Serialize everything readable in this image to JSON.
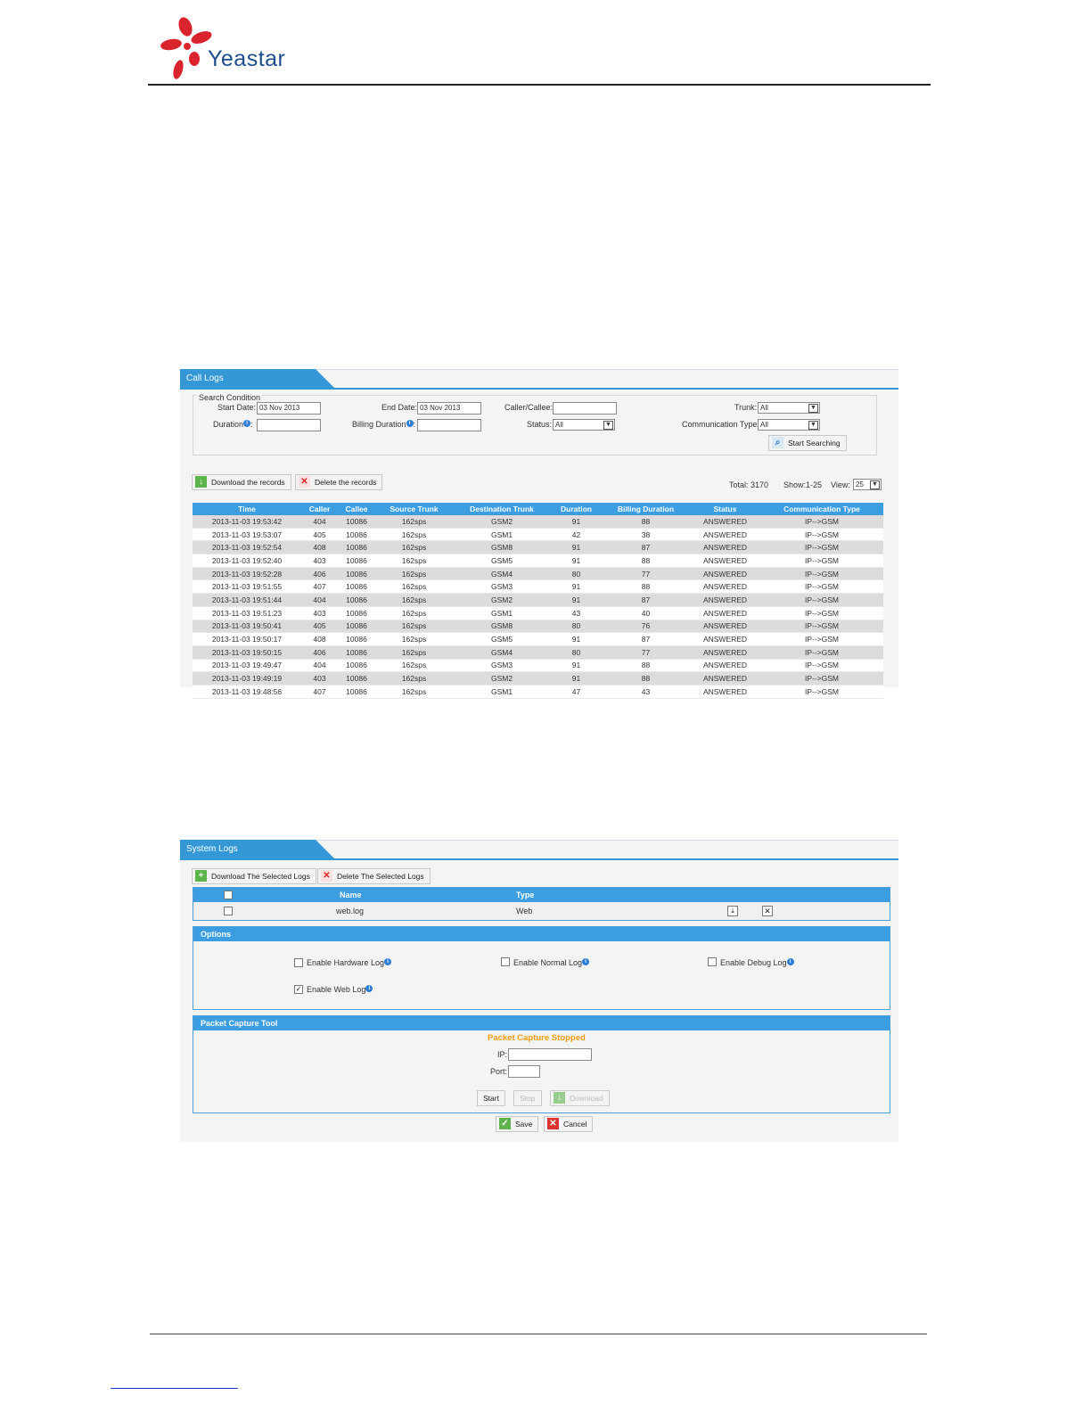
{
  "brand": {
    "name": "Yeastar"
  },
  "call_logs": {
    "tab_title": "Call Logs",
    "search": {
      "legend": "Search Condition",
      "start_date_label": "Start Date:",
      "start_date_value": "03 Nov 2013",
      "end_date_label": "End Date:",
      "end_date_value": "03 Nov 2013",
      "caller_label": "Caller/Callee:",
      "caller_value": "",
      "trunk_label": "Trunk:",
      "trunk_value": "All",
      "duration_label": "Duration",
      "billing_label": "Billing Duration",
      "status_label": "Status:",
      "status_value": "All",
      "comm_label": "Communication Type:",
      "comm_value": "All",
      "search_button": "Start Searching"
    },
    "download_button": "Download the records",
    "delete_button": "Delete the records",
    "total_label": "Total: 3170",
    "show_label": "Show:1-25",
    "view_label": "View:",
    "view_value": "25",
    "columns": [
      "Time",
      "Caller",
      "Callee",
      "Source Trunk",
      "Destination Trunk",
      "Duration",
      "Billing Duration",
      "Status",
      "Communication Type"
    ],
    "rows": [
      [
        "2013-11-03 19:53:42",
        "404",
        "10086",
        "162sps",
        "GSM2",
        "91",
        "88",
        "ANSWERED",
        "IP-->GSM"
      ],
      [
        "2013-11-03 19:53:07",
        "405",
        "10086",
        "162sps",
        "GSM1",
        "42",
        "38",
        "ANSWERED",
        "IP-->GSM"
      ],
      [
        "2013-11-03 19:52:54",
        "408",
        "10086",
        "162sps",
        "GSM8",
        "91",
        "87",
        "ANSWERED",
        "IP-->GSM"
      ],
      [
        "2013-11-03 19:52:40",
        "403",
        "10086",
        "162sps",
        "GSM5",
        "91",
        "88",
        "ANSWERED",
        "IP-->GSM"
      ],
      [
        "2013-11-03 19:52:28",
        "406",
        "10086",
        "162sps",
        "GSM4",
        "80",
        "77",
        "ANSWERED",
        "IP-->GSM"
      ],
      [
        "2013-11-03 19:51:55",
        "407",
        "10086",
        "162sps",
        "GSM3",
        "91",
        "88",
        "ANSWERED",
        "IP-->GSM"
      ],
      [
        "2013-11-03 19:51:44",
        "404",
        "10086",
        "162sps",
        "GSM2",
        "91",
        "87",
        "ANSWERED",
        "IP-->GSM"
      ],
      [
        "2013-11-03 19:51:23",
        "403",
        "10086",
        "162sps",
        "GSM1",
        "43",
        "40",
        "ANSWERED",
        "IP-->GSM"
      ],
      [
        "2013-11-03 19:50:41",
        "405",
        "10086",
        "162sps",
        "GSM8",
        "80",
        "76",
        "ANSWERED",
        "IP-->GSM"
      ],
      [
        "2013-11-03 19:50:17",
        "408",
        "10086",
        "162sps",
        "GSM5",
        "91",
        "87",
        "ANSWERED",
        "IP-->GSM"
      ],
      [
        "2013-11-03 19:50:15",
        "406",
        "10086",
        "162sps",
        "GSM4",
        "80",
        "77",
        "ANSWERED",
        "IP-->GSM"
      ],
      [
        "2013-11-03 19:49:47",
        "404",
        "10086",
        "162sps",
        "GSM3",
        "91",
        "88",
        "ANSWERED",
        "IP-->GSM"
      ],
      [
        "2013-11-03 19:49:19",
        "403",
        "10086",
        "162sps",
        "GSM2",
        "91",
        "88",
        "ANSWERED",
        "IP-->GSM"
      ],
      [
        "2013-11-03 19:48:56",
        "407",
        "10086",
        "162sps",
        "GSM1",
        "47",
        "43",
        "ANSWERED",
        "IP-->GSM"
      ]
    ]
  },
  "system_logs": {
    "tab_title": "System Logs",
    "download_button": "Download The Selected Logs",
    "delete_button": "Delete The Selected Logs",
    "columns": [
      "Name",
      "Type"
    ],
    "rows": [
      {
        "name": "web.log",
        "type": "Web"
      }
    ],
    "options": {
      "title": "Options",
      "hardware": {
        "label": "Enable Hardware Log",
        "checked": false
      },
      "normal": {
        "label": "Enable Normal Log",
        "checked": false
      },
      "debug": {
        "label": "Enable Debug Log",
        "checked": false
      },
      "web": {
        "label": "Enable Web Log",
        "checked": true
      }
    },
    "packet_capture": {
      "title": "Packet Capture Tool",
      "status": "Packet Capture Stopped",
      "ip_label": "IP:",
      "port_label": "Port:",
      "start_button": "Start",
      "stop_button": "Stop",
      "download_button": "Download"
    },
    "save_button": "Save",
    "cancel_button": "Cancel"
  },
  "colors": {
    "accent": "#3498d6",
    "status_orange": "#f39c12",
    "brand_blue": "#1e4e8c",
    "logo_red": "#d9232d"
  }
}
